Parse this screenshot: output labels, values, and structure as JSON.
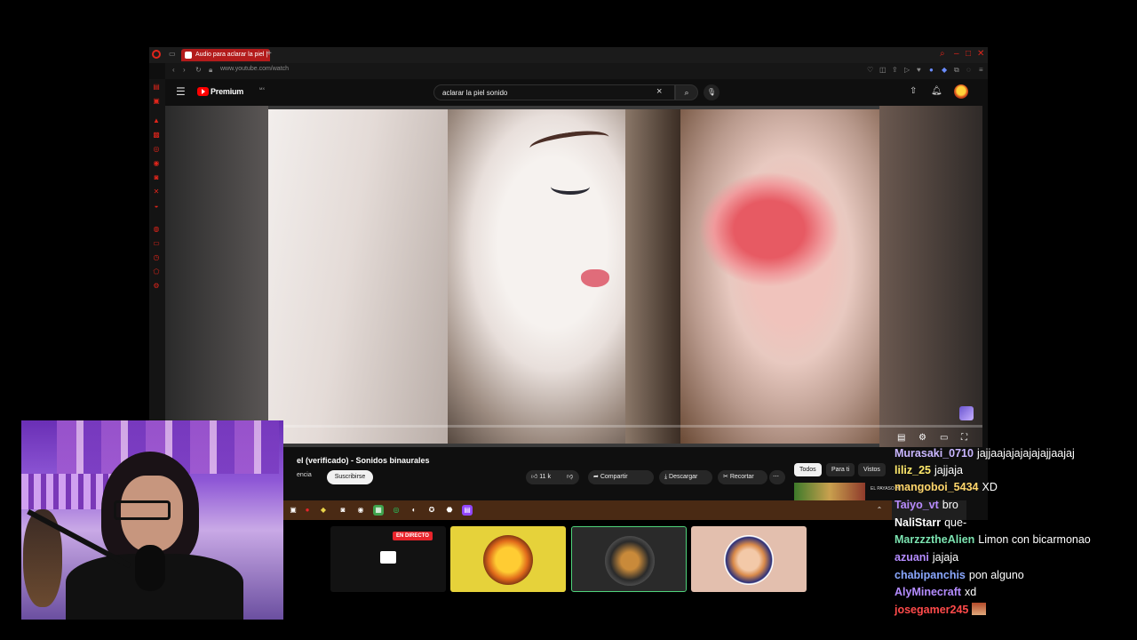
{
  "browser": {
    "tab_title": "Audio para aclarar la piel |",
    "url": "www.youtube.com/watch",
    "new_tab": "+"
  },
  "youtube": {
    "brand": "Premium",
    "region": "MX",
    "search_value": "aclarar la piel sonido",
    "video_title": "el (verificado) - Sonidos binaurales",
    "channel_fragment": "encia",
    "subscribe": "Suscribirse",
    "likes": "11 k",
    "share": "Compartir",
    "download": "Descargar",
    "clip": "Recortar",
    "more": "⋯",
    "chips": [
      "Todos",
      "Para ti",
      "Vistos"
    ],
    "side_video_title": "EL PAYASO H",
    "progress": 0.14
  },
  "raid": {
    "live_badge": "EN DIRECTO"
  },
  "chat": {
    "messages": [
      {
        "user": "Murasaki_0710",
        "color": "#c9b6ff",
        "text": "jajjaajajajajajajjaajaj"
      },
      {
        "user": "liliz_25",
        "color": "#ffe96b",
        "text": "jajjaja"
      },
      {
        "user": "mangoboi_5434",
        "color": "#ffd66b",
        "text": "XD"
      },
      {
        "user": "Taiyo_vt",
        "color": "#b98cff",
        "text": "bro"
      },
      {
        "user": "NaliStarr",
        "color": "#ffffff",
        "text": "que-"
      },
      {
        "user": "MarzzztheAlien",
        "color": "#7be3b0",
        "text": "Limon con bicarmonao"
      },
      {
        "user": "azuani",
        "color": "#b48cff",
        "text": "jajaja"
      },
      {
        "user": "chabipanchis",
        "color": "#8aa8ff",
        "text": "pon alguno"
      },
      {
        "user": "AlyMinecraft",
        "color": "#b48cff",
        "text": "xd"
      },
      {
        "user": "josegamer245",
        "color": "#ff4a4a",
        "text": ""
      }
    ]
  }
}
